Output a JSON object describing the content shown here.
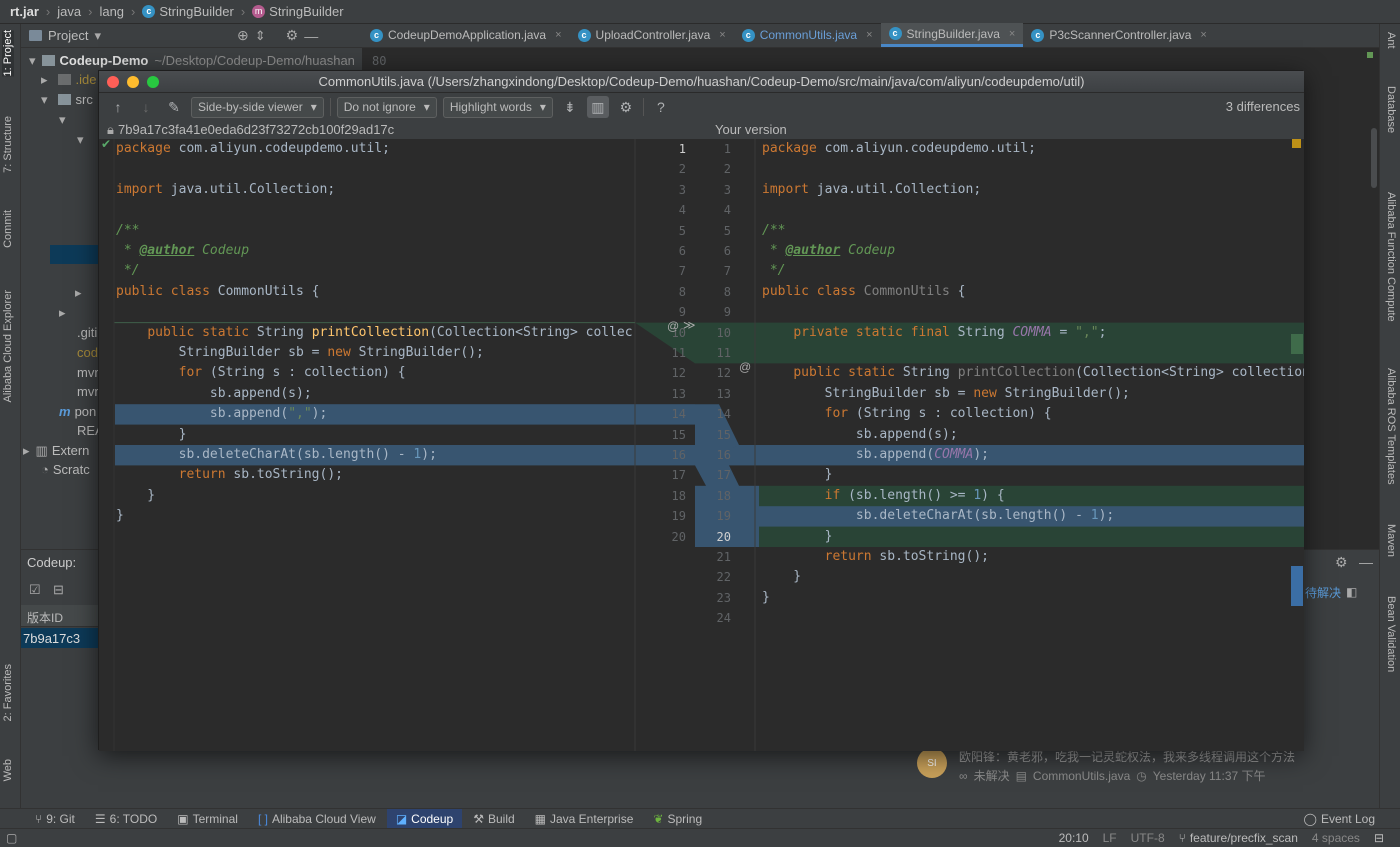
{
  "breadcrumb": [
    "rt.jar",
    "java",
    "lang",
    "StringBuilder",
    "StringBuilder"
  ],
  "left_tabs": [
    "1: Project",
    "7: Structure",
    "Commit",
    "Alibaba Cloud Explorer",
    "2: Favorites",
    "Web"
  ],
  "right_tabs": [
    "Ant",
    "Database",
    "Alibaba Function Compute",
    "Alibaba ROS Templates",
    "Maven",
    "Bean Validation"
  ],
  "project": {
    "title": "Project",
    "root": "Codeup-Demo",
    "root_path": "~/Desktop/Codeup-Demo/huashan",
    "items": [
      ".ide",
      "src",
      ".giti",
      "cod",
      "mvr",
      "mvr",
      "pon",
      "REA",
      "Extern",
      "Scratc"
    ]
  },
  "editor_tabs": [
    "CodeupDemoApplication.java",
    "UploadController.java",
    "CommonUtils.java",
    "StringBuilder.java",
    "P3cScannerController.java"
  ],
  "editor_bg_line": "80",
  "dialog": {
    "title": "CommonUtils.java (/Users/zhangxindong/Desktop/Codeup-Demo/huashan/Codeup-Demo/src/main/java/com/aliyun/codeupdemo/util)",
    "viewer": "Side-by-side viewer",
    "ignore": "Do not ignore",
    "highlight": "Highlight words",
    "help": "?",
    "differences": "3 differences",
    "left_header": "7b9a17c3fa41e0eda6d23f73272cb100f29ad17c",
    "right_header": "Your version",
    "left_numbers": [
      "1",
      "2",
      "3",
      "4",
      "5",
      "6",
      "7",
      "8",
      "9",
      "10",
      "11",
      "12",
      "13",
      "14",
      "15",
      "16",
      "17",
      "18",
      "19",
      "20"
    ],
    "right_numbers": [
      "1",
      "2",
      "3",
      "4",
      "5",
      "6",
      "7",
      "8",
      "9",
      "10",
      "11",
      "12",
      "13",
      "14",
      "15",
      "16",
      "17",
      "18",
      "19",
      "20",
      "21",
      "22",
      "23",
      "24"
    ],
    "left_code": [
      [
        [
          "package",
          "kw"
        ],
        [
          " com.aliyun.codeupdemo.util;",
          ""
        ]
      ],
      [],
      [
        [
          "import",
          "kw"
        ],
        [
          " java.util.Collection;",
          ""
        ]
      ],
      [],
      [
        [
          "/**",
          "cm"
        ]
      ],
      [
        [
          " * ",
          "cm"
        ],
        [
          "@author",
          "tag"
        ],
        [
          " Codeup",
          "cm"
        ]
      ],
      [
        [
          " */",
          "cm"
        ]
      ],
      [
        [
          "public class",
          "kw"
        ],
        [
          " CommonUtils {",
          ""
        ]
      ],
      [],
      [
        [
          "    ",
          ""
        ],
        [
          "public static",
          "kw"
        ],
        [
          " String ",
          ""
        ],
        [
          "printCollection",
          "fn"
        ],
        [
          "(Collection<String> collec",
          ""
        ]
      ],
      [
        [
          "        StringBuilder sb = ",
          ""
        ],
        [
          "new",
          "kw"
        ],
        [
          " StringBuilder();",
          ""
        ]
      ],
      [
        [
          "        ",
          ""
        ],
        [
          "for",
          "kw"
        ],
        [
          " (String s : collection) {",
          ""
        ]
      ],
      [
        [
          "            sb.append(s);",
          ""
        ]
      ],
      [
        [
          "            sb.append(",
          ""
        ],
        [
          "\",\"",
          "str"
        ],
        [
          ");",
          ""
        ]
      ],
      [
        [
          "        }",
          ""
        ]
      ],
      [
        [
          "        sb.deleteCharAt(sb.length() - ",
          ""
        ],
        [
          "1",
          "num"
        ],
        [
          ");",
          ""
        ]
      ],
      [
        [
          "        ",
          ""
        ],
        [
          "return",
          "kw"
        ],
        [
          " sb.toString();",
          ""
        ]
      ],
      [
        [
          "    }",
          ""
        ]
      ],
      [
        [
          "}",
          ""
        ]
      ],
      []
    ],
    "right_code": [
      [
        [
          "package",
          "kw"
        ],
        [
          " com.aliyun.codeupdemo.util;",
          ""
        ]
      ],
      [],
      [
        [
          "import",
          "kw"
        ],
        [
          " java.util.Collection;",
          ""
        ]
      ],
      [],
      [
        [
          "/**",
          "cm"
        ]
      ],
      [
        [
          " * ",
          "cm"
        ],
        [
          "@author",
          "tag"
        ],
        [
          " Codeup",
          "cm"
        ]
      ],
      [
        [
          " */",
          "cm"
        ]
      ],
      [
        [
          "public class",
          "kw"
        ],
        [
          " ",
          ""
        ],
        [
          "CommonUtils",
          "gray"
        ],
        [
          " {",
          ""
        ]
      ],
      [],
      [
        [
          "    ",
          ""
        ],
        [
          "private static final",
          "kw"
        ],
        [
          " String ",
          ""
        ],
        [
          "COMMA",
          "cst"
        ],
        [
          " = ",
          ""
        ],
        [
          "\",\"",
          "str"
        ],
        [
          ";",
          ""
        ]
      ],
      [],
      [
        [
          "    ",
          ""
        ],
        [
          "public static",
          "kw"
        ],
        [
          " String ",
          ""
        ],
        [
          "printCollection",
          "gray"
        ],
        [
          "(Collection<String> collection",
          ""
        ]
      ],
      [
        [
          "        StringBuilder sb = ",
          ""
        ],
        [
          "new",
          "kw"
        ],
        [
          " StringBuilder();",
          ""
        ]
      ],
      [
        [
          "        ",
          ""
        ],
        [
          "for",
          "kw"
        ],
        [
          " (String s : collection) {",
          ""
        ]
      ],
      [
        [
          "            sb.append(s);",
          ""
        ]
      ],
      [
        [
          "            sb.append(",
          ""
        ],
        [
          "COMMA",
          "cst"
        ],
        [
          ");",
          ""
        ]
      ],
      [
        [
          "        }",
          ""
        ]
      ],
      [
        [
          "        ",
          ""
        ],
        [
          "if",
          "kw"
        ],
        [
          " (sb.length() >= ",
          ""
        ],
        [
          "1",
          "num"
        ],
        [
          ") {",
          ""
        ]
      ],
      [
        [
          "            sb.deleteCharAt(sb.length() - ",
          ""
        ],
        [
          "1",
          "num"
        ],
        [
          ");",
          ""
        ]
      ],
      [
        [
          "        }",
          ""
        ]
      ],
      [
        [
          "        ",
          ""
        ],
        [
          "return",
          "kw"
        ],
        [
          " sb.toString();",
          ""
        ]
      ],
      [
        [
          "    }",
          ""
        ]
      ],
      [
        [
          "}",
          ""
        ]
      ],
      []
    ]
  },
  "codeup": {
    "title": "Codeup:",
    "col_header": "版本ID",
    "row_id": "7b9a17c3",
    "resolve_label": "待解决",
    "comment_text": "欧阳锋：黄老邪，吃我一记灵蛇权法，我来多线程调用这个方法",
    "comment_status": "未解决",
    "comment_file": "CommonUtils.java",
    "comment_time": "Yesterday 11:37 下午",
    "avatar": "SI"
  },
  "bottom_tabs": [
    "9: Git",
    "6: TODO",
    "Terminal",
    "Alibaba Cloud View",
    "Codeup",
    "Build",
    "Java Enterprise",
    "Spring"
  ],
  "event_log": "Event Log",
  "status": {
    "position": "20:10",
    "line_sep": "LF",
    "encoding": "UTF-8",
    "branch": "feature/precfix_scan",
    "indent": "4 spaces"
  }
}
